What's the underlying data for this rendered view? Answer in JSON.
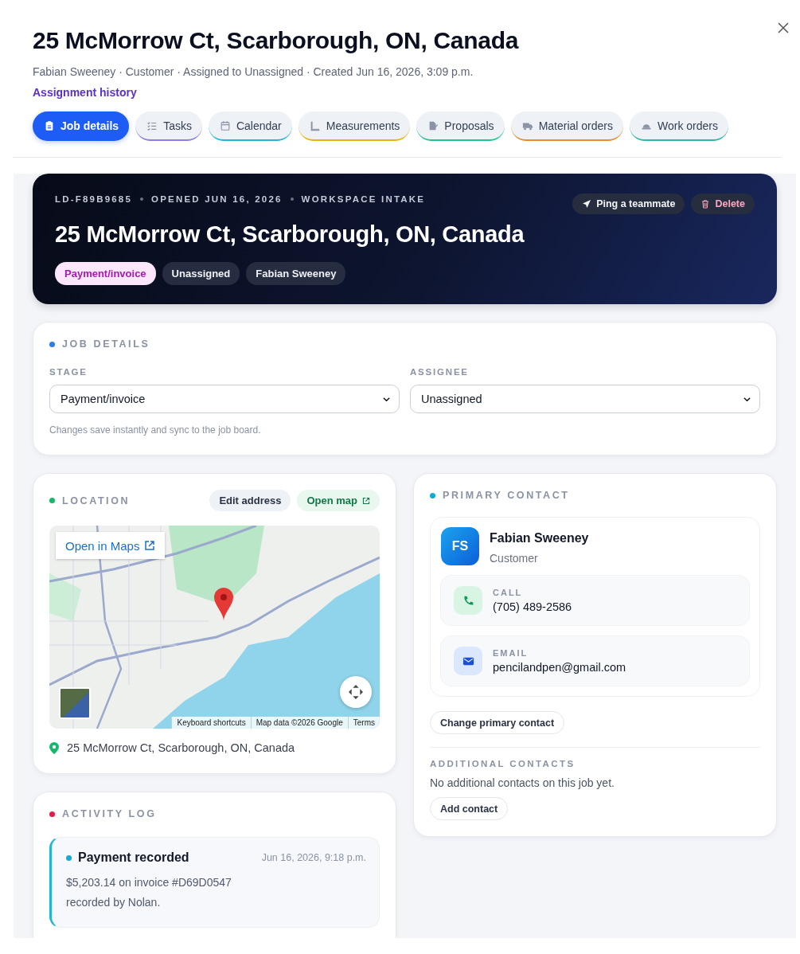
{
  "header": {
    "title": "25 McMorrow Ct, Scarborough, ON, Canada",
    "meta": "Fabian Sweeney · Customer · Assigned to Unassigned · Created Jun 16, 2026, 3:09 p.m.",
    "history_link": "Assignment history"
  },
  "tabs": [
    {
      "label": "Job details",
      "selected": true,
      "color": "#1d5cf5"
    },
    {
      "label": "Tasks",
      "selected": false,
      "color": "#8b7cf0"
    },
    {
      "label": "Calendar",
      "selected": false,
      "color": "#22b5d6"
    },
    {
      "label": "Measurements",
      "selected": false,
      "color": "#eab308"
    },
    {
      "label": "Proposals",
      "selected": false,
      "color": "#22c38e"
    },
    {
      "label": "Material orders",
      "selected": false,
      "color": "#f08a24"
    },
    {
      "label": "Work orders",
      "selected": false,
      "color": "#2bb7a0"
    }
  ],
  "hero": {
    "meta": [
      "LD-F89B9685",
      "OPENED JUN 16, 2026",
      "WORKSPACE INTAKE"
    ],
    "title": "25 McMorrow Ct, Scarborough, ON, Canada",
    "actions": [
      {
        "label": "Ping a teammate",
        "kind": "ping"
      },
      {
        "label": "Delete",
        "kind": "delete"
      }
    ],
    "tags": [
      {
        "label": "Payment/invoice",
        "kind": "stage"
      },
      {
        "label": "Unassigned",
        "kind": "plain"
      },
      {
        "label": "Fabian Sweeney",
        "kind": "plain"
      }
    ]
  },
  "job_details": {
    "heading": "JOB DETAILS",
    "fields": [
      {
        "label": "STAGE",
        "value": "Payment/invoice"
      },
      {
        "label": "ASSIGNEE",
        "value": "Unassigned"
      }
    ],
    "hint": "Changes save instantly and sync to the job board."
  },
  "location": {
    "heading": "LOCATION",
    "edit_button": "Edit address",
    "open_button": "Open map",
    "map": {
      "open_in_maps": "Open in Maps",
      "attribution": [
        "Keyboard shortcuts",
        "Map data ©2026 Google",
        "Terms"
      ]
    },
    "address": "25 McMorrow Ct, Scarborough, ON, Canada"
  },
  "activity_log": {
    "heading": "ACTIVITY LOG",
    "items": [
      {
        "title": "Payment recorded",
        "time": "Jun 16, 2026, 9:18 p.m.",
        "text": "$5,203.14 on invoice #D69D0547 recorded by Nolan."
      }
    ]
  },
  "primary_contact": {
    "heading": "PRIMARY CONTACT",
    "initials": "FS",
    "name": "Fabian Sweeney",
    "role": "Customer",
    "methods": [
      {
        "kind": "call",
        "label": "CALL",
        "value": "(705) 489-2586"
      },
      {
        "kind": "email",
        "label": "EMAIL",
        "value": "pencilandpen@gmail.com"
      }
    ],
    "change_button": "Change primary contact",
    "additional_heading": "ADDITIONAL CONTACTS",
    "additional_empty": "No additional contacts on this job yet.",
    "add_button": "Add contact"
  }
}
